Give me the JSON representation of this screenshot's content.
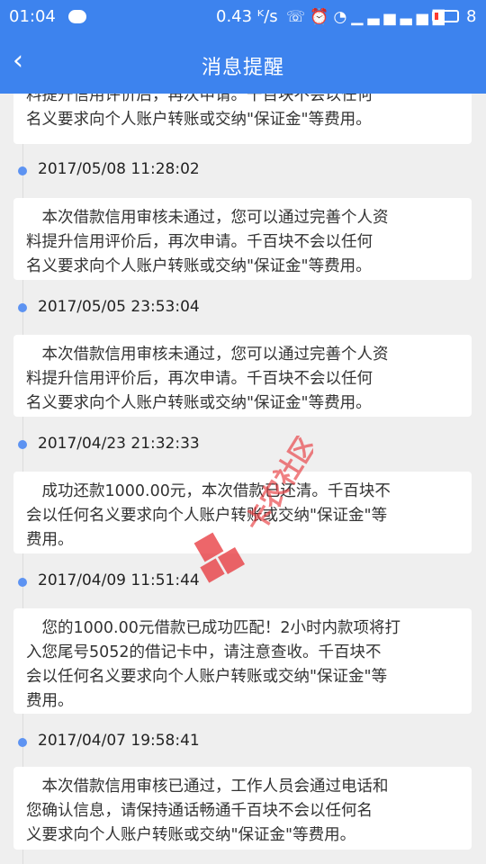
{
  "status_bar": {
    "time": "01:04",
    "speed": "0.43 ᴷ/s",
    "battery": "8",
    "icons": [
      "chat-icon",
      "phone-icon",
      "alarm-icon",
      "wifi-icon",
      "signal-icon",
      "signal-icon",
      "battery-icon"
    ]
  },
  "header": {
    "back_icon": "chevron-left-icon",
    "title": "消息提醒"
  },
  "messages": [
    {
      "date": "",
      "text": "料提升信用评价后，再次申请。千百块不会以任何\n名义要求向个人账户转账或交纳\"保证金\"等费用。"
    },
    {
      "date": "2017/05/08  11:28:02",
      "text": "本次借款信用审核未通过，您可以通过完善个人资\n料提升信用评价后，再次申请。千百块不会以任何\n名义要求向个人账户转账或交纳\"保证金\"等费用。"
    },
    {
      "date": "2017/05/05  23:53:04",
      "text": "本次借款信用审核未通过，您可以通过完善个人资\n料提升信用评价后，再次申请。千百块不会以任何\n名义要求向个人账户转账或交纳\"保证金\"等费用。"
    },
    {
      "date": "2017/04/23  21:32:33",
      "text": "成功还款1000.00元，本次借款已还清。千百块不\n会以任何名义要求向个人账户转账或交纳\"保证金\"等\n费用。"
    },
    {
      "date": "2017/04/09  11:51:44",
      "text": "您的1000.00元借款已成功匹配！2小时内款项将打\n入您尾号5052的借记卡中，请注意查收。千百块不\n会以任何名义要求向个人账户转账或交纳\"保证金\"等\n费用。"
    },
    {
      "date": "2017/04/07  19:58:41",
      "text": "本次借款信用审核已通过，工作人员会通过电话和\n您确认信息，请保持通话畅通千百块不会以任何名\n义要求向个人账户转账或交纳\"保证金\"等费用。"
    }
  ],
  "watermark": {
    "text": "卡农社区",
    "color": "#e8383d"
  },
  "colors": {
    "accent": "#3d83ee",
    "dot": "#5d93f2",
    "background": "#efefef"
  }
}
